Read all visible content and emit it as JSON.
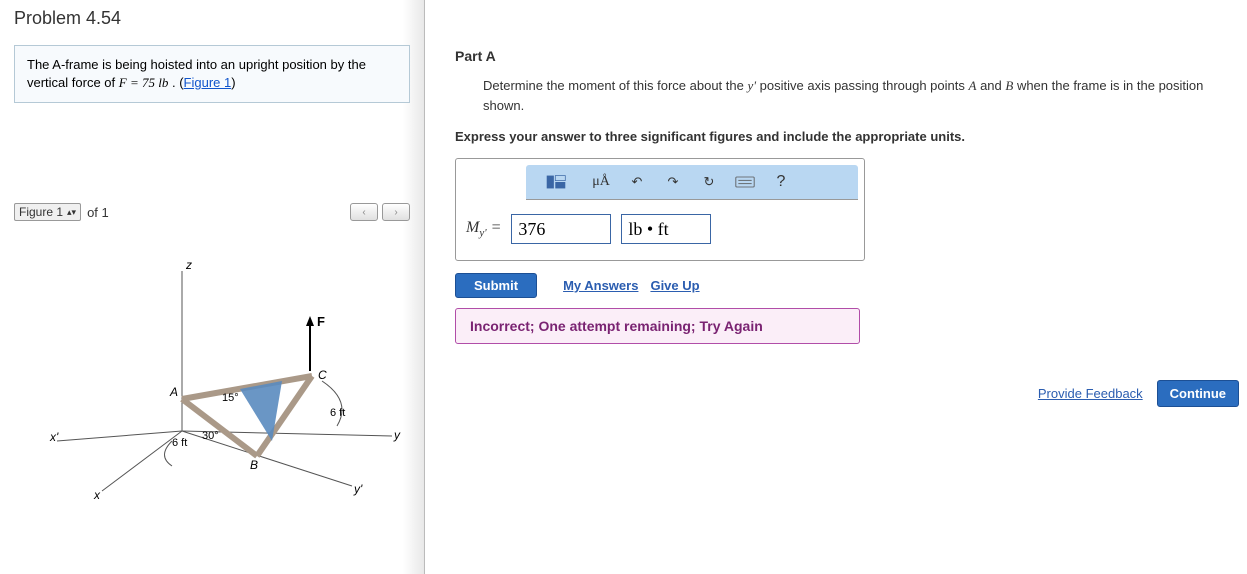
{
  "problem": {
    "title": "Problem 4.54",
    "statement_pre": "The A-frame is being hoisted into an upright position by the vertical force of ",
    "statement_force": "F = 75  lb",
    "statement_post": " . (",
    "figure_link": "Figure 1",
    "statement_end": ")"
  },
  "figure_bar": {
    "label": "Figure 1",
    "of": "of 1"
  },
  "figure_labels": {
    "z": "z",
    "x": "x",
    "xp": "x'",
    "y": "y",
    "yp": "y'",
    "A": "A",
    "B": "B",
    "C": "C",
    "F": "F",
    "angle15": "15°",
    "angle30": "30°",
    "len6a": "6 ft",
    "len6b": "6 ft"
  },
  "partA": {
    "heading": "Part A",
    "question_pre": "Determine the moment of this force about the ",
    "question_axis": "y'",
    "question_mid": " positive axis passing through points ",
    "question_A": "A",
    "question_and": " and ",
    "question_B": "B",
    "question_post": " when the frame is in the position shown.",
    "instruction": "Express your answer to three significant figures and include the appropriate units.",
    "var_label": "M",
    "var_sub": "y'",
    "equals": " = ",
    "value": "376",
    "unit": "lb • ft",
    "submit": "Submit",
    "my_answers": "My Answers",
    "give_up": "Give Up",
    "feedback": "Incorrect; One attempt remaining; Try Again",
    "toolbar_mu": "μÅ",
    "toolbar_help": "?"
  },
  "footer": {
    "provide_feedback": "Provide Feedback",
    "continue": "Continue"
  }
}
